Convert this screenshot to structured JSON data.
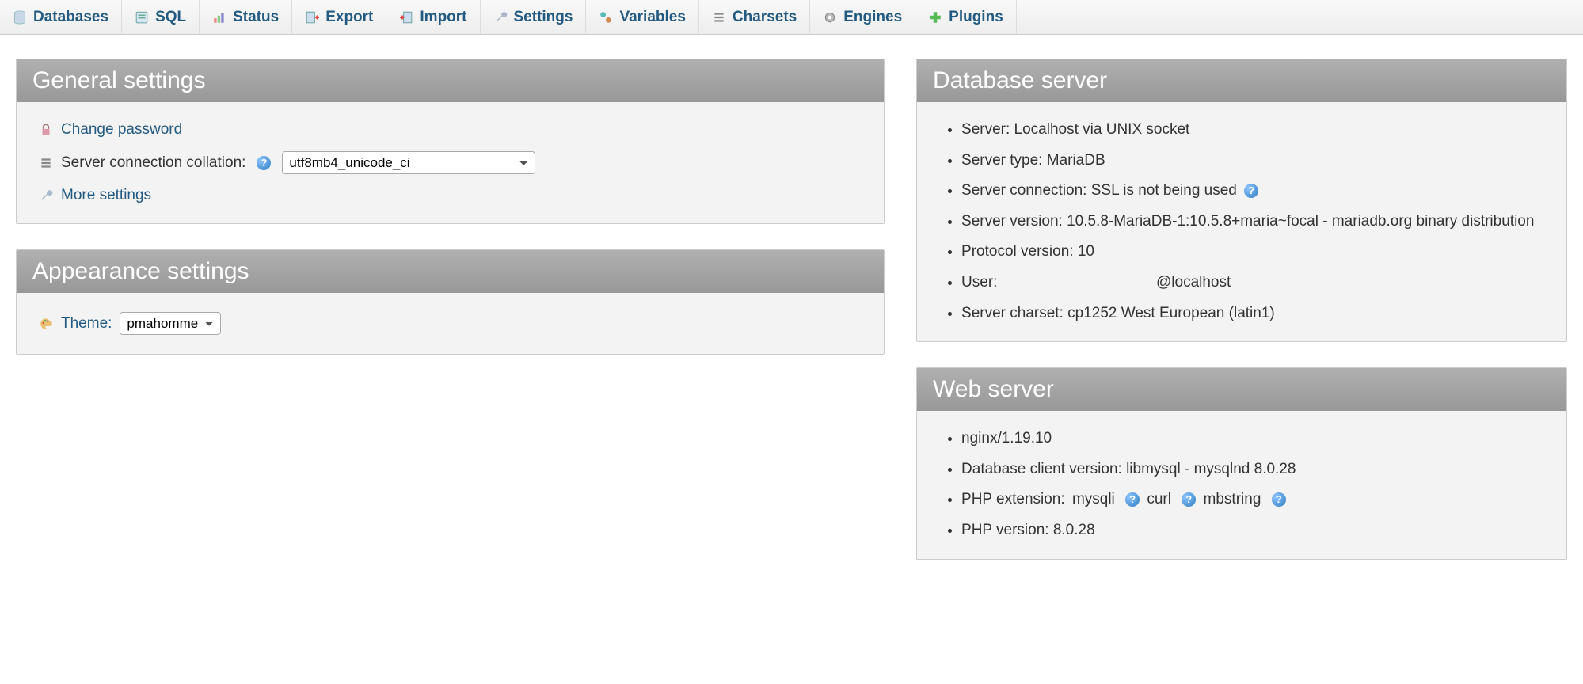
{
  "tabs": {
    "databases": "Databases",
    "sql": "SQL",
    "status": "Status",
    "export": "Export",
    "import": "Import",
    "settings": "Settings",
    "variables": "Variables",
    "charsets": "Charsets",
    "engines": "Engines",
    "plugins": "Plugins"
  },
  "general": {
    "title": "General settings",
    "change_password": "Change password",
    "collation_label": "Server connection collation:",
    "collation_value": "utf8mb4_unicode_ci",
    "more_settings": "More settings"
  },
  "appearance": {
    "title": "Appearance settings",
    "theme_label": "Theme:",
    "theme_value": "pmahomme"
  },
  "dbserver": {
    "title": "Database server",
    "server": "Server: Localhost via UNIX socket",
    "type": "Server type: MariaDB",
    "connection": "Server connection: SSL is not being used",
    "version": "Server version: 10.5.8-MariaDB-1:10.5.8+maria~focal - mariadb.org binary distribution",
    "protocol": "Protocol version: 10",
    "user_label": "User:",
    "user_host": "@localhost",
    "charset": "Server charset: cp1252 West European (latin1)"
  },
  "webserver": {
    "title": "Web server",
    "nginx": "nginx/1.19.10",
    "client": "Database client version: libmysql - mysqlnd 8.0.28",
    "ext_label": "PHP extension:",
    "ext1": "mysqli",
    "ext2": "curl",
    "ext3": "mbstring",
    "php": "PHP version: 8.0.28"
  }
}
